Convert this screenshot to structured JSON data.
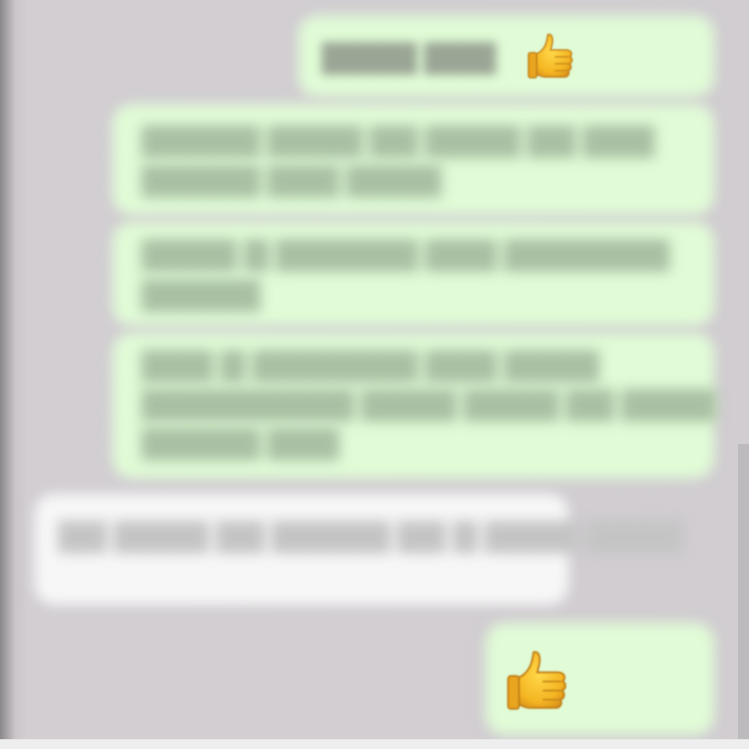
{
  "messages": [
    {
      "text_lines": [
        "ᅟᅟ ᅟᅟ"
      ],
      "time": "",
      "has_emoji": true
    },
    {
      "text_lines": [
        "",
        ""
      ],
      "time": ""
    },
    {
      "text_lines": [
        "",
        ""
      ],
      "time": ""
    },
    {
      "text_lines": [
        "",
        "",
        ""
      ],
      "time": ""
    },
    {
      "text_lines": [
        "",
        ""
      ],
      "time": ""
    },
    {
      "text_lines": [],
      "time": "",
      "has_emoji": true
    }
  ],
  "colors": {
    "outgoing_bubble": "#e0fbd6",
    "incoming_bubble": "#f7f7f7",
    "background": "#d1cdd1"
  },
  "icons": [
    "thumbs-up-icon",
    "thumbs-up-icon"
  ]
}
